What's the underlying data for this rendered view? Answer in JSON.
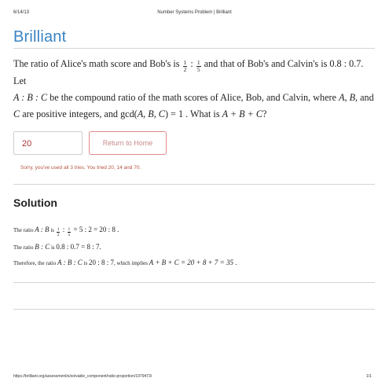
{
  "print_header": {
    "date": "6/14/13",
    "title": "Number Systems Problem | Brilliant"
  },
  "logo": "Brilliant",
  "problem": {
    "p1": "The ratio of Alice's math score and Bob's is ",
    "half_n": "1",
    "half_d": "2",
    "colon": " : ",
    "fifth_n": "1",
    "fifth_d": "5",
    "p2": "  and that of Bob's and Calvin's is ",
    "ratio_bc": "0.8 : 0.7",
    "p3": ". Let",
    "abc": "A : B : C",
    "p4": "  be the compound ratio of the math scores of Alice, Bob, and Calvin, where ",
    "vars": "A, B,",
    "p5": "  and ",
    "var_c": "C",
    "p6": " are positive integers, and gcd(",
    "gcd_args": "A, B, C",
    "p7": ") = 1 . What is ",
    "question": "A + B + C",
    "p8": "?"
  },
  "answer": {
    "value": "20"
  },
  "return_button": "Return to Home",
  "tries_message": "Sorry, you've used all 3 tries. You tried 20, 14 and 70.",
  "solution": {
    "heading": "Solution",
    "l1_pre": "The ratio ",
    "l1_ab": "A : B",
    "l1_is": " is ",
    "l1_half_n": "1",
    "l1_half_d": "2",
    "l1_colon": " : ",
    "l1_fifth_n": "1",
    "l1_fifth_d": "5",
    "l1_rest": " = 5 : 2 = 20 : 8 .",
    "l2_pre": "The ratio ",
    "l2_bc": "B : C",
    "l2_is": " is ",
    "l2_rest": "0.8 : 0.7 = 8 : 7.",
    "l3_pre": "Therefore, the ratio ",
    "l3_abc": "A : B : C",
    "l3_is": " is ",
    "l3_val": "20 : 8 : 7",
    "l3_mid": ", which implies ",
    "l3_eq": "A + B + C = 20 + 8 + 7 = 35",
    "l3_end": "  ."
  },
  "print_footer": {
    "url": "https://brilliant.org/assessment/s/solvable_component/ratio-proportion/1979473/",
    "page": "1/1"
  }
}
